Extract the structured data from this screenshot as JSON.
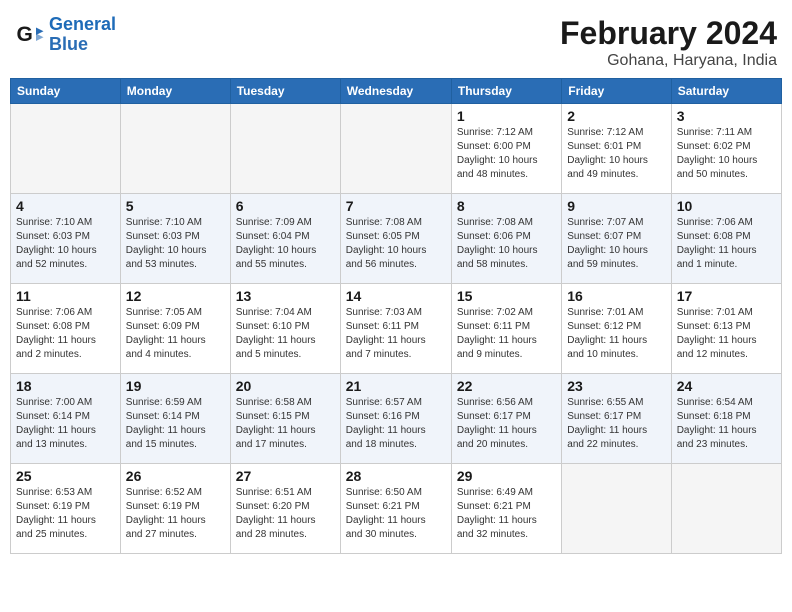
{
  "header": {
    "logo_general": "General",
    "logo_blue": "Blue",
    "title": "February 2024",
    "subtitle": "Gohana, Haryana, India"
  },
  "days_of_week": [
    "Sunday",
    "Monday",
    "Tuesday",
    "Wednesday",
    "Thursday",
    "Friday",
    "Saturday"
  ],
  "weeks": [
    [
      {
        "day": "",
        "info": ""
      },
      {
        "day": "",
        "info": ""
      },
      {
        "day": "",
        "info": ""
      },
      {
        "day": "",
        "info": ""
      },
      {
        "day": "1",
        "info": "Sunrise: 7:12 AM\nSunset: 6:00 PM\nDaylight: 10 hours\nand 48 minutes."
      },
      {
        "day": "2",
        "info": "Sunrise: 7:12 AM\nSunset: 6:01 PM\nDaylight: 10 hours\nand 49 minutes."
      },
      {
        "day": "3",
        "info": "Sunrise: 7:11 AM\nSunset: 6:02 PM\nDaylight: 10 hours\nand 50 minutes."
      }
    ],
    [
      {
        "day": "4",
        "info": "Sunrise: 7:10 AM\nSunset: 6:03 PM\nDaylight: 10 hours\nand 52 minutes."
      },
      {
        "day": "5",
        "info": "Sunrise: 7:10 AM\nSunset: 6:03 PM\nDaylight: 10 hours\nand 53 minutes."
      },
      {
        "day": "6",
        "info": "Sunrise: 7:09 AM\nSunset: 6:04 PM\nDaylight: 10 hours\nand 55 minutes."
      },
      {
        "day": "7",
        "info": "Sunrise: 7:08 AM\nSunset: 6:05 PM\nDaylight: 10 hours\nand 56 minutes."
      },
      {
        "day": "8",
        "info": "Sunrise: 7:08 AM\nSunset: 6:06 PM\nDaylight: 10 hours\nand 58 minutes."
      },
      {
        "day": "9",
        "info": "Sunrise: 7:07 AM\nSunset: 6:07 PM\nDaylight: 10 hours\nand 59 minutes."
      },
      {
        "day": "10",
        "info": "Sunrise: 7:06 AM\nSunset: 6:08 PM\nDaylight: 11 hours\nand 1 minute."
      }
    ],
    [
      {
        "day": "11",
        "info": "Sunrise: 7:06 AM\nSunset: 6:08 PM\nDaylight: 11 hours\nand 2 minutes."
      },
      {
        "day": "12",
        "info": "Sunrise: 7:05 AM\nSunset: 6:09 PM\nDaylight: 11 hours\nand 4 minutes."
      },
      {
        "day": "13",
        "info": "Sunrise: 7:04 AM\nSunset: 6:10 PM\nDaylight: 11 hours\nand 5 minutes."
      },
      {
        "day": "14",
        "info": "Sunrise: 7:03 AM\nSunset: 6:11 PM\nDaylight: 11 hours\nand 7 minutes."
      },
      {
        "day": "15",
        "info": "Sunrise: 7:02 AM\nSunset: 6:11 PM\nDaylight: 11 hours\nand 9 minutes."
      },
      {
        "day": "16",
        "info": "Sunrise: 7:01 AM\nSunset: 6:12 PM\nDaylight: 11 hours\nand 10 minutes."
      },
      {
        "day": "17",
        "info": "Sunrise: 7:01 AM\nSunset: 6:13 PM\nDaylight: 11 hours\nand 12 minutes."
      }
    ],
    [
      {
        "day": "18",
        "info": "Sunrise: 7:00 AM\nSunset: 6:14 PM\nDaylight: 11 hours\nand 13 minutes."
      },
      {
        "day": "19",
        "info": "Sunrise: 6:59 AM\nSunset: 6:14 PM\nDaylight: 11 hours\nand 15 minutes."
      },
      {
        "day": "20",
        "info": "Sunrise: 6:58 AM\nSunset: 6:15 PM\nDaylight: 11 hours\nand 17 minutes."
      },
      {
        "day": "21",
        "info": "Sunrise: 6:57 AM\nSunset: 6:16 PM\nDaylight: 11 hours\nand 18 minutes."
      },
      {
        "day": "22",
        "info": "Sunrise: 6:56 AM\nSunset: 6:17 PM\nDaylight: 11 hours\nand 20 minutes."
      },
      {
        "day": "23",
        "info": "Sunrise: 6:55 AM\nSunset: 6:17 PM\nDaylight: 11 hours\nand 22 minutes."
      },
      {
        "day": "24",
        "info": "Sunrise: 6:54 AM\nSunset: 6:18 PM\nDaylight: 11 hours\nand 23 minutes."
      }
    ],
    [
      {
        "day": "25",
        "info": "Sunrise: 6:53 AM\nSunset: 6:19 PM\nDaylight: 11 hours\nand 25 minutes."
      },
      {
        "day": "26",
        "info": "Sunrise: 6:52 AM\nSunset: 6:19 PM\nDaylight: 11 hours\nand 27 minutes."
      },
      {
        "day": "27",
        "info": "Sunrise: 6:51 AM\nSunset: 6:20 PM\nDaylight: 11 hours\nand 28 minutes."
      },
      {
        "day": "28",
        "info": "Sunrise: 6:50 AM\nSunset: 6:21 PM\nDaylight: 11 hours\nand 30 minutes."
      },
      {
        "day": "29",
        "info": "Sunrise: 6:49 AM\nSunset: 6:21 PM\nDaylight: 11 hours\nand 32 minutes."
      },
      {
        "day": "",
        "info": ""
      },
      {
        "day": "",
        "info": ""
      }
    ]
  ]
}
